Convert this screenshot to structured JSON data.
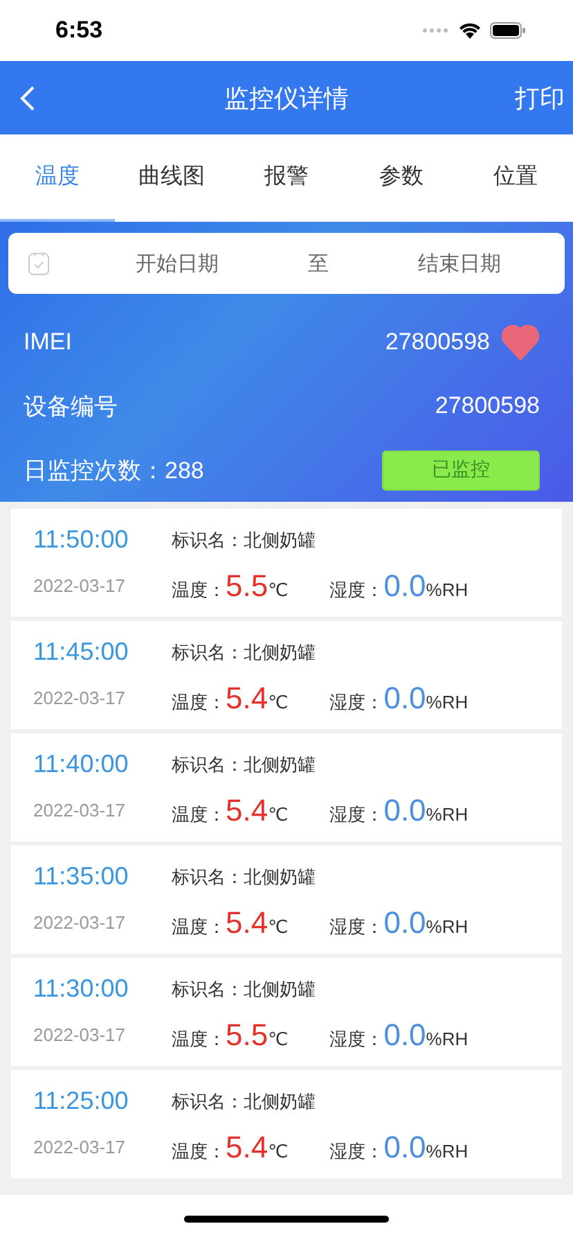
{
  "status_bar": {
    "time": "6:53"
  },
  "nav": {
    "title": "监控仪详情",
    "action": "打印"
  },
  "tabs": [
    {
      "label": "温度",
      "selected": true
    },
    {
      "label": "曲线图",
      "selected": false
    },
    {
      "label": "报警",
      "selected": false
    },
    {
      "label": "参数",
      "selected": false
    },
    {
      "label": "位置",
      "selected": false
    }
  ],
  "date_range": {
    "start_placeholder": "开始日期",
    "separator": "至",
    "end_placeholder": "结束日期"
  },
  "device": {
    "imei_label": "IMEI",
    "imei": "27800598",
    "favorite": true,
    "number_label": "设备编号",
    "number": "27800598",
    "count_label": "日监控次数：",
    "count": "288",
    "monitor_button": "已监控"
  },
  "records": [
    {
      "time": "11:50:00",
      "date": "2022-03-17",
      "name_label": "标识名：",
      "name": "北侧奶罐",
      "temp_label": "温度：",
      "temp": "5.5",
      "temp_unit": "℃",
      "hum_label": "湿度：",
      "hum": "0.0",
      "hum_unit": "%RH"
    },
    {
      "time": "11:45:00",
      "date": "2022-03-17",
      "name_label": "标识名：",
      "name": "北侧奶罐",
      "temp_label": "温度：",
      "temp": "5.4",
      "temp_unit": "℃",
      "hum_label": "湿度：",
      "hum": "0.0",
      "hum_unit": "%RH"
    },
    {
      "time": "11:40:00",
      "date": "2022-03-17",
      "name_label": "标识名：",
      "name": "北侧奶罐",
      "temp_label": "温度：",
      "temp": "5.4",
      "temp_unit": "℃",
      "hum_label": "湿度：",
      "hum": "0.0",
      "hum_unit": "%RH"
    },
    {
      "time": "11:35:00",
      "date": "2022-03-17",
      "name_label": "标识名：",
      "name": "北侧奶罐",
      "temp_label": "温度：",
      "temp": "5.4",
      "temp_unit": "℃",
      "hum_label": "湿度：",
      "hum": "0.0",
      "hum_unit": "%RH"
    },
    {
      "time": "11:30:00",
      "date": "2022-03-17",
      "name_label": "标识名：",
      "name": "北侧奶罐",
      "temp_label": "温度：",
      "temp": "5.5",
      "temp_unit": "℃",
      "hum_label": "湿度：",
      "hum": "0.0",
      "hum_unit": "%RH"
    },
    {
      "time": "11:25:00",
      "date": "2022-03-17",
      "name_label": "标识名：",
      "name": "北侧奶罐",
      "temp_label": "温度：",
      "temp": "5.4",
      "temp_unit": "℃",
      "hum_label": "湿度：",
      "hum": "0.0",
      "hum_unit": "%RH"
    }
  ]
}
